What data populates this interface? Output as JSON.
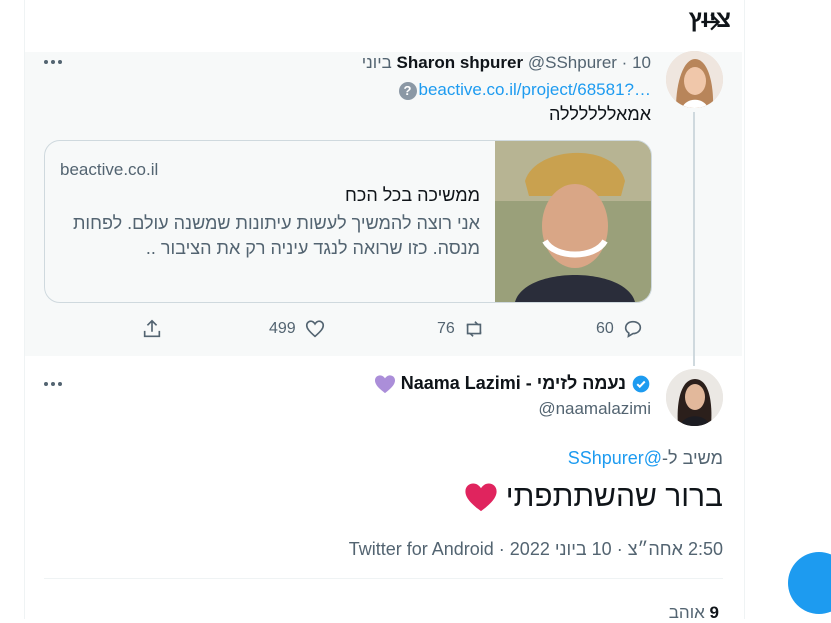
{
  "header": {
    "title": "ציוץ",
    "back_icon": "arrow-right-icon"
  },
  "parent_tweet": {
    "name": "Sharon shpurer",
    "handle": "@SShpurer",
    "separator": "·",
    "date": "10 ביוני",
    "link": "beactive.co.il/project/68581?…",
    "text": "אמאללללללה",
    "card": {
      "domain": "beactive.co.il",
      "title": "ממשיכה בכל הכח",
      "description": "אני רוצה להמשיך לעשות עיתונות שמשנה עולם. לפחות מנסה. כזו שרואה לנגד עיניה רק את הציבור .."
    },
    "actions": {
      "replies": "60",
      "retweets": "76",
      "likes": "499"
    }
  },
  "main_tweet": {
    "name": "נעמה לזימי - Naama Lazimi",
    "handle": "@naamalazimi",
    "reply_prefix": "משיב ל-",
    "reply_mention": "@SShpurer",
    "text": "ברור שהשתתפתי",
    "time": "2:50 אחה״צ",
    "separator": "·",
    "date": "10 ביוני 2022",
    "source": "Twitter for Android",
    "likes_count": "9",
    "likes_label": "אוהב"
  },
  "colors": {
    "accent": "#1d9bf0",
    "text": "#0f1419",
    "muted": "#536471",
    "heart": "#e0245e"
  }
}
